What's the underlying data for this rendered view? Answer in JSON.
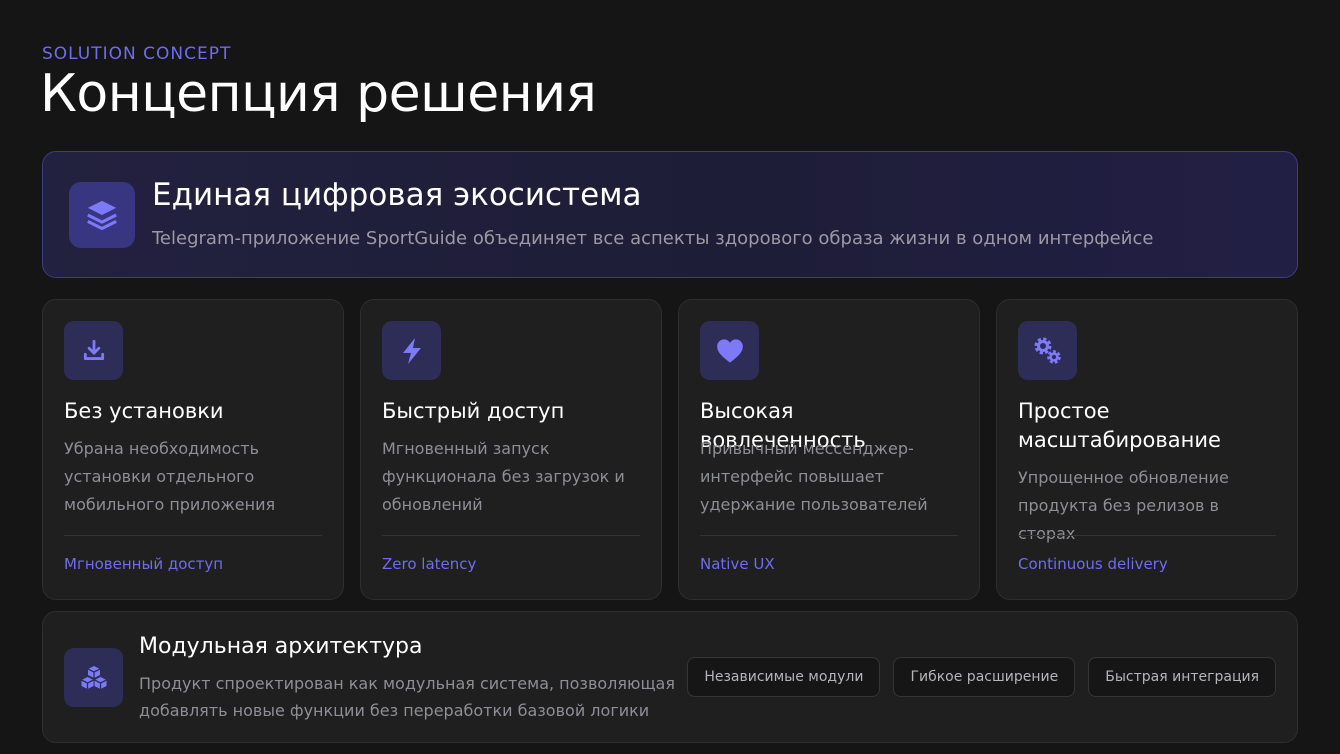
{
  "header": {
    "eyebrow": "SOLUTION CONCEPT",
    "title": "Концепция решения"
  },
  "hero": {
    "icon": "layers-icon",
    "title": "Единая цифровая экосистема",
    "subtitle": "Telegram-приложение SportGuide объединяет все аспекты здорового образа жизни в одном интерфейсе"
  },
  "cards": [
    {
      "icon": "download-icon",
      "title": "Без установки",
      "description": "Убрана необходимость установки отдельного мобильного приложения",
      "tag": "Мгновенный доступ"
    },
    {
      "icon": "lightning-icon",
      "title": "Быстрый доступ",
      "description": "Мгновенный запуск функционала без загрузок и обновлений",
      "tag": "Zero latency"
    },
    {
      "icon": "heart-icon",
      "title": "Высокая вовлеченность",
      "description": "Привычный мессенджер-интерфейс повышает удержание пользователей",
      "tag": "Native UX"
    },
    {
      "icon": "gears-icon",
      "title": "Простое масштабирование",
      "description": "Упрощенное обновление продукта без релизов в сторах",
      "tag": "Continuous delivery"
    }
  ],
  "architecture": {
    "icon": "cubes-icon",
    "title": "Модульная архитектура",
    "description": "Продукт спроектирован как модульная система, позволяющая добавлять новые функции без переработки базовой логики",
    "pills": [
      "Независимые модули",
      "Гибкое расширение",
      "Быстрая интеграция"
    ]
  },
  "colors": {
    "accent": "#6f6cf0",
    "background": "#151515",
    "card": "#1f1f1f"
  }
}
